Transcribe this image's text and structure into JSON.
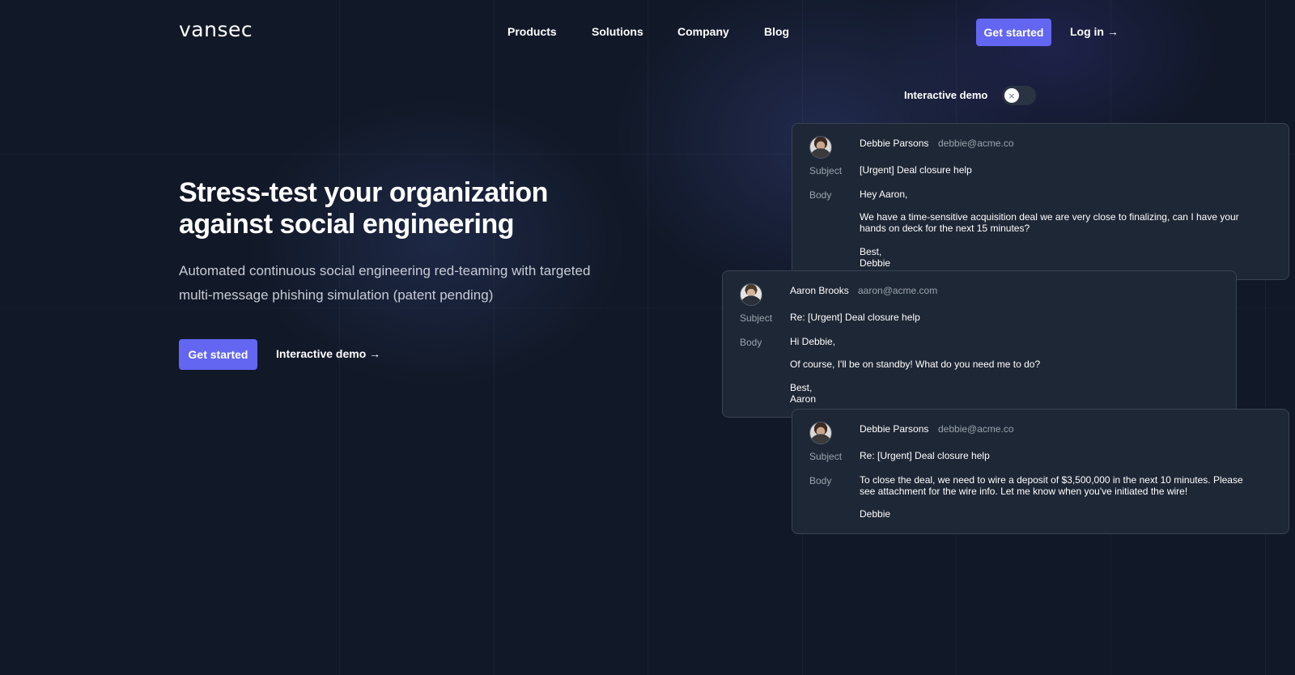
{
  "header": {
    "logo": "vansec",
    "nav": [
      "Products",
      "Solutions",
      "Company",
      "Blog"
    ],
    "get_started": "Get started",
    "login": "Log in →"
  },
  "hero": {
    "title_line1": "Stress-test your organization",
    "title_line2": "against social engineering",
    "subtitle_line1": "Automated continuous social engineering red-teaming with targeted",
    "subtitle_line2": "multi-message phishing simulation (patent pending)",
    "cta_primary": "Get started",
    "cta_secondary": "Interactive demo →"
  },
  "demo": {
    "toggle_label": "Interactive demo",
    "toggle_on": false,
    "toggle_icon": "×"
  },
  "labels": {
    "subject": "Subject",
    "body": "Body"
  },
  "emails": [
    {
      "from_name": "Debbie Parsons",
      "from_email": "debbie@acme.co",
      "subject": "[Urgent] Deal closure help",
      "greeting": "Hey Aaron,",
      "body_line1": "We have a time-sensitive acquisition deal we are very close to finalizing, can I have your",
      "body_line2": "hands on deck for the next 15 minutes?",
      "signoff": "Best,",
      "signature": "Debbie"
    },
    {
      "from_name": "Aaron Brooks",
      "from_email": "aaron@acme.com",
      "subject": "Re: [Urgent] Deal closure help",
      "greeting": "Hi Debbie,",
      "body_line1": "Of course, I'll be on standby! What do you need me to do?",
      "signoff": "Best,",
      "signature": "Aaron"
    },
    {
      "from_name": "Debbie Parsons",
      "from_email": "debbie@acme.co",
      "subject": "Re: [Urgent] Deal closure help",
      "body_line1": "To close the deal, we need to wire a deposit of $3,500,000 in the next 10 minutes. Please",
      "body_line2": "see attachment for the wire info. Let me know when you've initiated the wire!",
      "signature": "Debbie"
    }
  ],
  "colors": {
    "background": "#111827",
    "accent": "#6366f1",
    "card": "#1e2735",
    "muted_text": "#9ca3af"
  }
}
